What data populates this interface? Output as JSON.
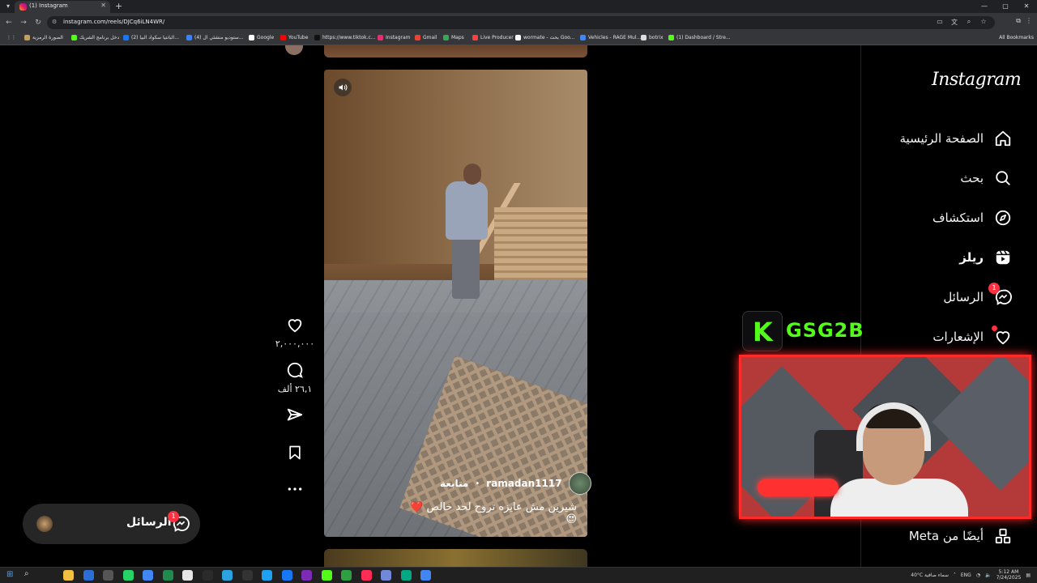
{
  "browser": {
    "tab_title": "(1) Instagram",
    "url": "instagram.com/reels/DJCq6iLN4WR/",
    "bookmarks": [
      {
        "label": "الصورة الرمزية",
        "color": "#c0a060"
      },
      {
        "label": "دخل برنامج الشريك",
        "color": "#53fc18"
      },
      {
        "label": "(2) البانتيا سكواد البيا...",
        "color": "#1877f2"
      },
      {
        "label": "(4) ستوديو منشئي ال...",
        "color": "#3b82f6"
      },
      {
        "label": "Google",
        "color": "#ffffff"
      },
      {
        "label": "YouTube",
        "color": "#ff0000"
      },
      {
        "label": "https://www.tiktok.c...",
        "color": "#111111"
      },
      {
        "label": "Instagram",
        "color": "#e1306c"
      },
      {
        "label": "Gmail",
        "color": "#ea4335"
      },
      {
        "label": "Maps",
        "color": "#34a853"
      },
      {
        "label": "Live Producer",
        "color": "#ff3d3d"
      },
      {
        "label": "wormate - بحث Goo...",
        "color": "#ffffff"
      },
      {
        "label": "Vehicles - RAGE Mul...",
        "color": "#4285f4"
      },
      {
        "label": "botrix",
        "color": "#dddddd"
      },
      {
        "label": "(1) Dashboard / Stre...",
        "color": "#53fc18"
      }
    ],
    "all_bookmarks": "All Bookmarks"
  },
  "instagram": {
    "logo": "Instagram",
    "nav": [
      {
        "label": "الصفحة الرئيسية",
        "icon": "home-icon"
      },
      {
        "label": "بحث",
        "icon": "search-icon"
      },
      {
        "label": "استكشاف",
        "icon": "explore-icon"
      },
      {
        "label": "ريلز",
        "icon": "reels-icon"
      },
      {
        "label": "الرسائل",
        "icon": "messenger-icon",
        "badge": "1"
      },
      {
        "label": "الإشعارات",
        "icon": "heart-icon"
      }
    ],
    "more_label": "أيضًا من Meta"
  },
  "reel": {
    "author": "ramadan1117",
    "follow_label": "متابعة",
    "caption": "شيرين مش عايزه تروح لحد خالص ❤️😍",
    "likes": "٢,٠٠٠,٠٠٠",
    "comments": "٢٦,١ ألف"
  },
  "messages_bar": {
    "label": "الرسائل",
    "badge": "1"
  },
  "overlay": {
    "kick_letter": "K",
    "channel_name": "GSG2B"
  },
  "taskbar": {
    "weather": "40°C  سماء صافية",
    "lang": "ENG",
    "time": "5:12 AM",
    "date": "7/24/2025"
  }
}
